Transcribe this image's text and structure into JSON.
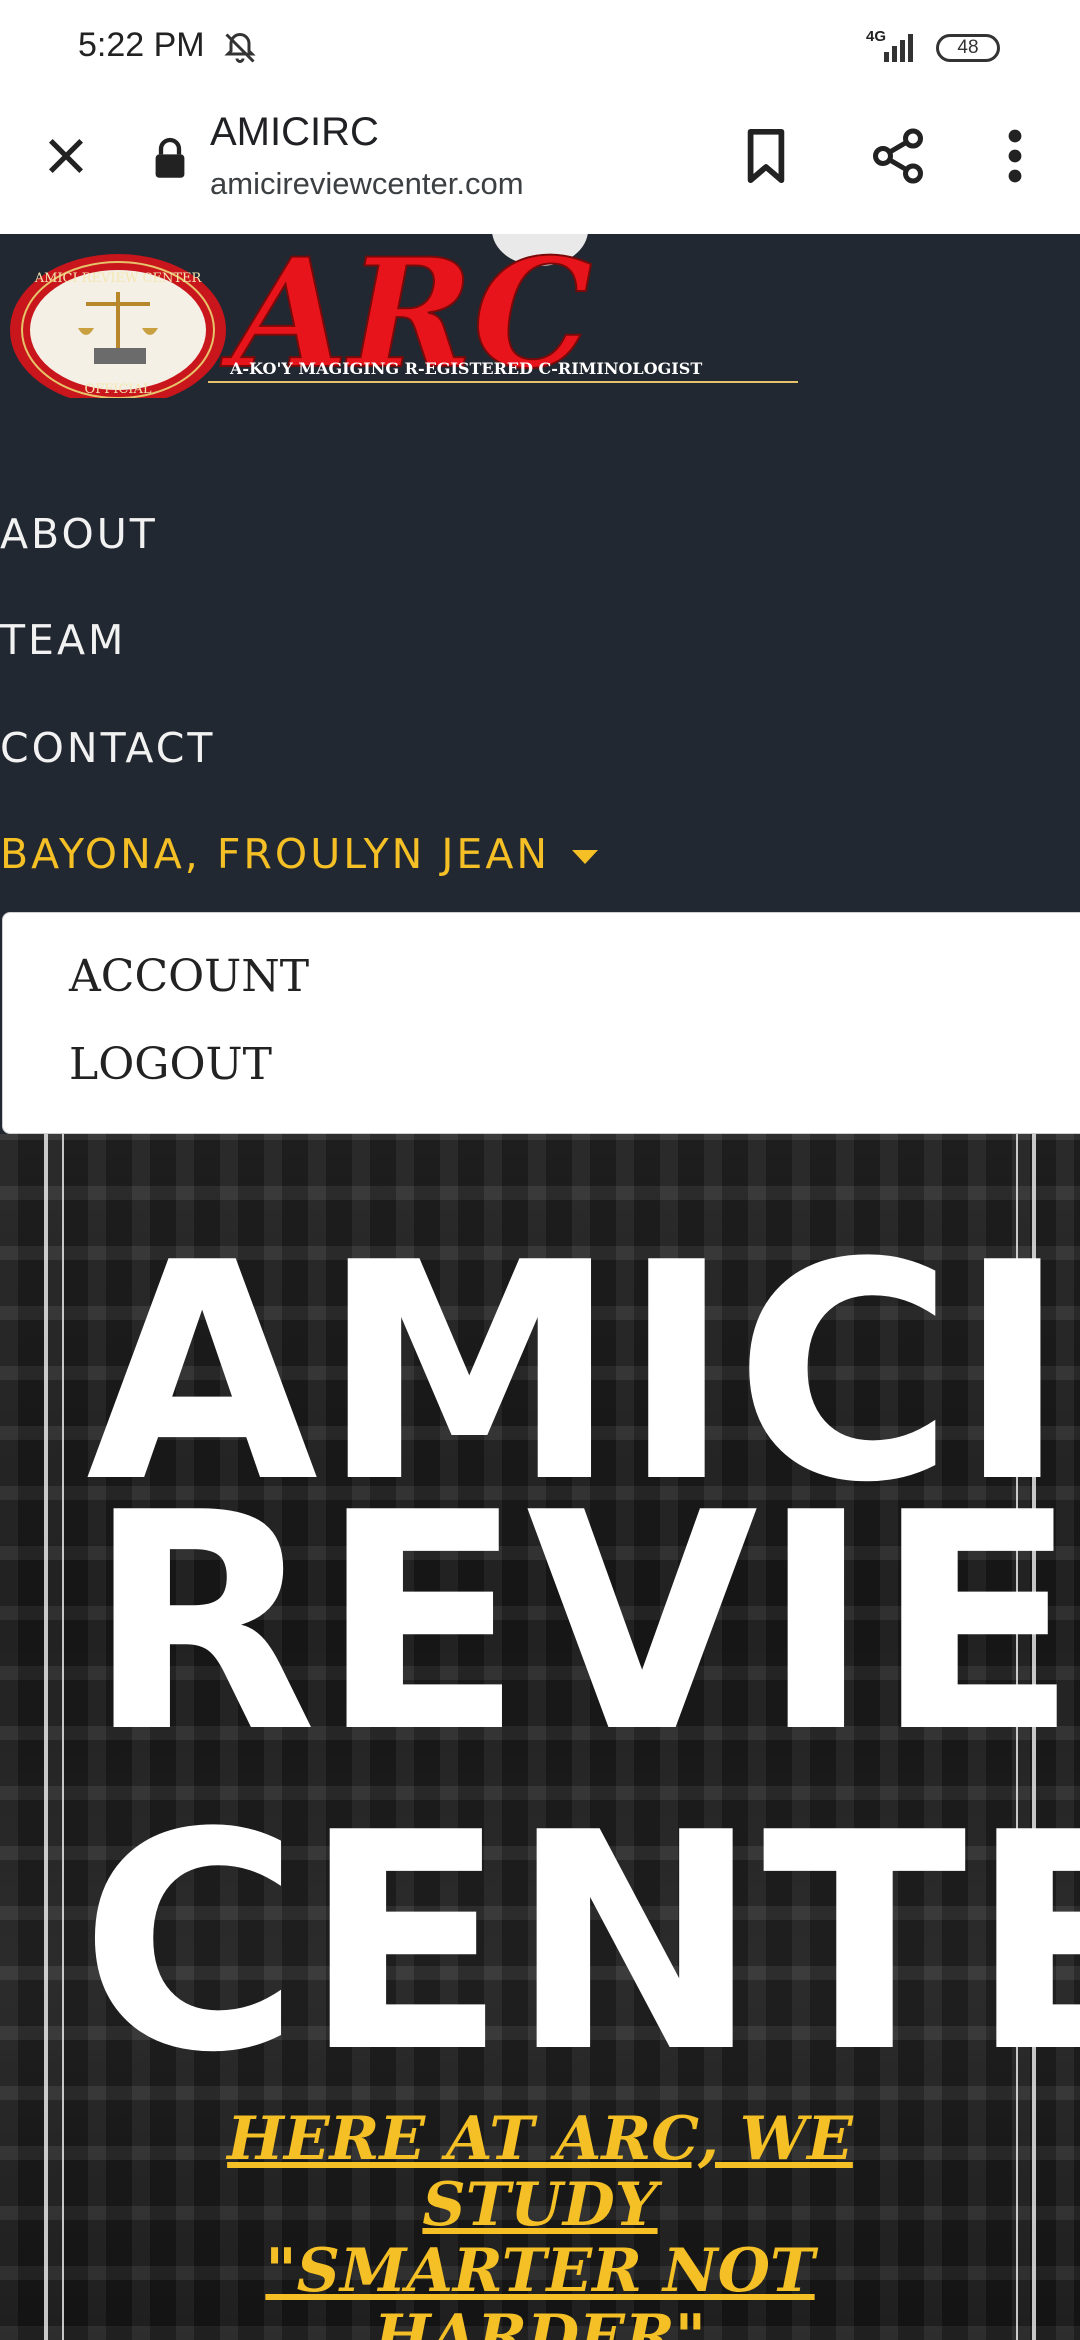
{
  "status_bar": {
    "time": "5:22 PM",
    "network": "4G",
    "battery": "48"
  },
  "browser": {
    "title": "AMICIRC",
    "url": "amicireviewcenter.com"
  },
  "logo": {
    "wordmark": "ARC",
    "tagline": "A-KO'Y MAGIGING R-EGISTERED C-RIMINOLOGIST",
    "seal_text_top": "AMICI REVIEW CENTER",
    "seal_text_bottom": "OFFICIAL"
  },
  "nav": {
    "items": [
      "ABOUT",
      "TEAM",
      "CONTACT"
    ],
    "user": "BAYONA, FROULYN JEAN"
  },
  "dropdown": {
    "items": [
      "ACCOUNT",
      "LOGOUT"
    ]
  },
  "hero": {
    "line1": "AMICI",
    "line2": "REVIEW",
    "line3": "CENTER",
    "tagline_line1": "HERE AT ARC, WE STUDY",
    "tagline_line2": "\"SMARTER NOT HARDER\""
  },
  "colors": {
    "page_bg": "#222831",
    "accent": "#f5c026",
    "logo_red": "#e8141b"
  }
}
